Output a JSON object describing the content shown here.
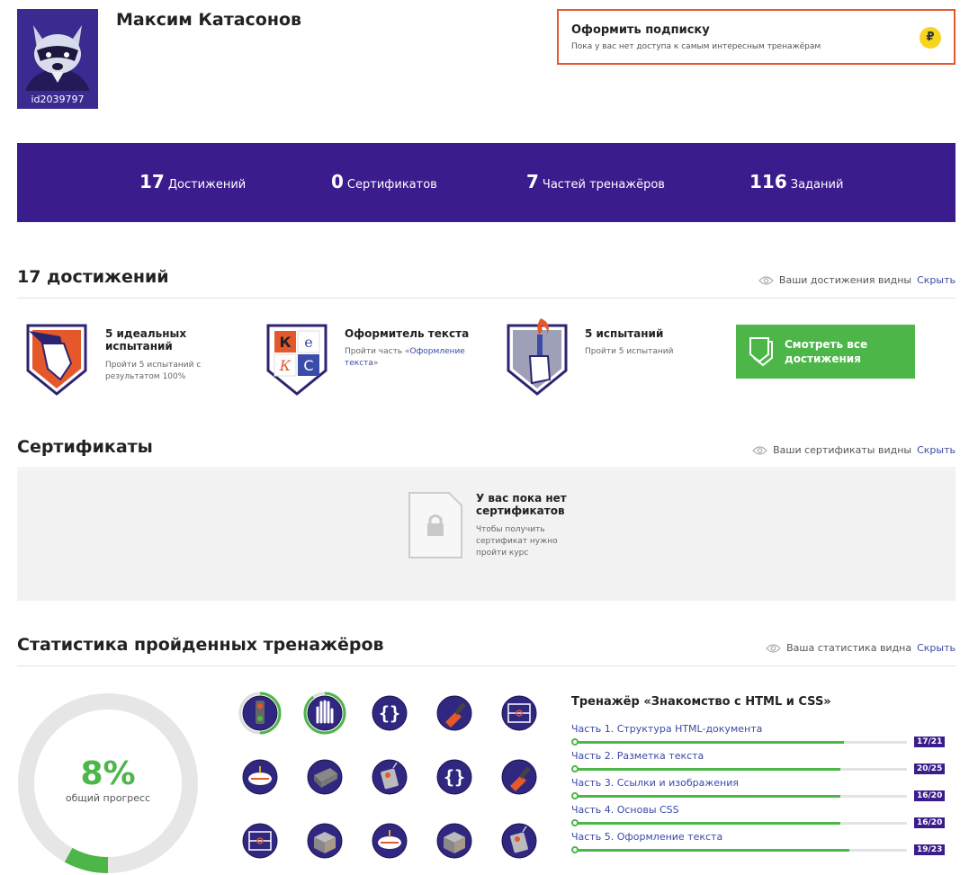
{
  "profile": {
    "name": "Максим Катасонов",
    "id": "id2039797"
  },
  "subscription": {
    "title": "Оформить подписку",
    "description": "Пока у вас нет доступа к самым интересным тренажёрам",
    "currency_symbol": "₽"
  },
  "stats": [
    {
      "value": "17",
      "label": "Достижений"
    },
    {
      "value": "0",
      "label": "Сертификатов"
    },
    {
      "value": "7",
      "label": "Частей тренажёров"
    },
    {
      "value": "116",
      "label": "Заданий"
    }
  ],
  "achievements": {
    "title": "17 достижений",
    "visibility": "Ваши достижения видны",
    "hide": "Скрыть",
    "items": [
      {
        "title": "5 идеальных испытаний",
        "desc": "Пройти 5 испытаний с результатом 100%",
        "icon": "gun-hand-icon"
      },
      {
        "title": "Оформитель текста",
        "desc_prefix": "Пройти часть «",
        "desc_link": "Оформление текста",
        "desc_suffix": "»",
        "icon": "text-styler-icon"
      },
      {
        "title": "5 испытаний",
        "desc": "Пройти 5 испытаний",
        "icon": "torch-hand-icon"
      }
    ],
    "see_all": "Смотреть все достижения",
    "badge_letters": [
      "К",
      "е",
      "К",
      "С"
    ]
  },
  "certificates": {
    "title": "Сертификаты",
    "visibility": "Ваши сертификаты видны",
    "hide": "Скрыть",
    "empty_title": "У вас пока нет сертификатов",
    "empty_desc": "Чтобы получить сертификат нужно пройти курс"
  },
  "statistics": {
    "title": "Статистика пройденных тренажёров",
    "visibility": "Ваша статистика видна",
    "hide": "Скрыть",
    "progress_value": "8%",
    "progress_label": "общий прогресс",
    "progress_fraction": 0.08,
    "trainer_title": "Тренажёр «Знакомство с HTML и CSS»",
    "parts": [
      {
        "name": "Часть 1. Структура HTML-документа",
        "done": 17,
        "total": 21,
        "badge": "17/21"
      },
      {
        "name": "Часть 2. Разметка текста",
        "done": 20,
        "total": 25,
        "badge": "20/25"
      },
      {
        "name": "Часть 3. Ссылки и изображения",
        "done": 16,
        "total": 20,
        "badge": "16/20"
      },
      {
        "name": "Часть 4. Основы CSS",
        "done": 16,
        "total": 20,
        "badge": "16/20"
      },
      {
        "name": "Часть 5. Оформление текста",
        "done": 19,
        "total": 23,
        "badge": "19/23"
      }
    ],
    "trainers": [
      {
        "icon": "traffic-light-icon",
        "progress": 0.5
      },
      {
        "icon": "palm-icon",
        "progress": 0.9
      },
      {
        "icon": "braces-icon",
        "progress": 0
      },
      {
        "icon": "paint-brush-icon",
        "progress": 0
      },
      {
        "icon": "football-field-icon",
        "progress": 0
      },
      {
        "icon": "spinning-top-icon",
        "progress": 0
      },
      {
        "icon": "lego-brick-icon",
        "progress": 0
      },
      {
        "icon": "remote-control-icon",
        "progress": 0
      },
      {
        "icon": "braces-icon",
        "progress": 0
      },
      {
        "icon": "paint-brush-icon",
        "progress": 0
      },
      {
        "icon": "football-field-icon",
        "progress": 0
      },
      {
        "icon": "rubik-cube-icon",
        "progress": 0
      },
      {
        "icon": "spinning-top-icon",
        "progress": 0
      },
      {
        "icon": "rubik-cube-icon",
        "progress": 0
      },
      {
        "icon": "remote-control-icon",
        "progress": 0
      }
    ]
  },
  "colors": {
    "brand": "#3a1c8c",
    "accent": "#4cb649",
    "orange": "#e4582b",
    "link": "#3b4ba8"
  }
}
